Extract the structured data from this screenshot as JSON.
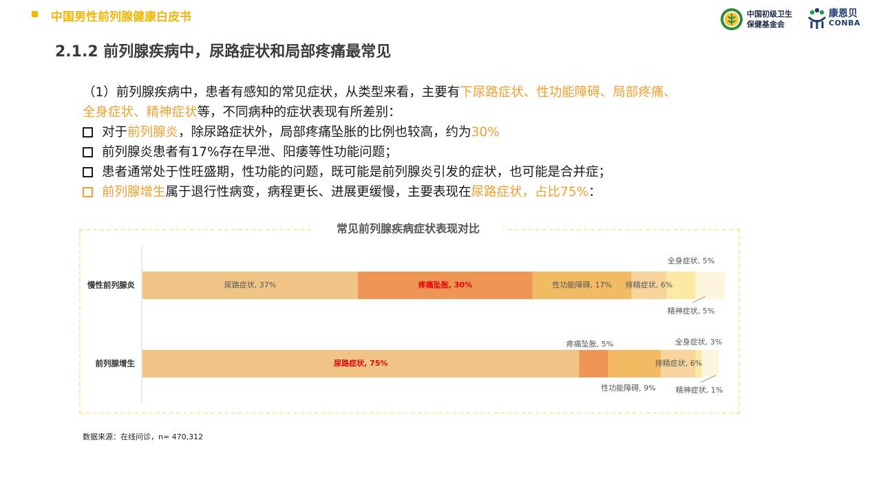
{
  "header": {
    "title": "中国男性前列腺健康白皮书",
    "org_logo_line1": "中国初级卫生",
    "org_logo_line2": "保健基金会",
    "brand_cn": "康恩贝",
    "brand_en": "CONBA"
  },
  "section_title": "2.1.2 前列腺疾病中，尿路症状和局部疼痛最常见",
  "paragraph": {
    "line1_a": "（1）前列腺疾病中，患者有感知的常见症状，从类型来看，主要有",
    "line1_hl": "下尿路症状、性功能障碍、局部疼痛、",
    "line2_hl": "全身症状、精神症状",
    "line2_b": "等，不同病种的症状表现有所差别："
  },
  "bullets": [
    {
      "a": "对于",
      "hl1": "前列腺炎",
      "b": "，除尿路症状外，局部疼痛坠胀的比例也较高，约为",
      "hl2": "30%"
    },
    {
      "text": "前列腺炎患者有17%存在早泄、阳痿等性功能问题；"
    },
    {
      "text": "患者通常处于性旺盛期，性功能的问题，既可能是前列腺炎引发的症状，也可能是合并症；"
    },
    {
      "hl1": "前列腺增生",
      "b": "属于退行性病变，病程更长、进展更缓慢，主要表现在",
      "hl2": "尿路症状，占比75%",
      "c": "："
    }
  ],
  "chart_data": {
    "type": "bar",
    "orientation": "horizontal",
    "stacked": true,
    "title": "常见前列腺疾病症状表现对比",
    "categories": [
      "慢性前列腺炎",
      "前列腺增生"
    ],
    "series": [
      {
        "name": "尿路症状",
        "values": [
          37,
          75
        ],
        "color": "#f0c485",
        "labels": [
          "尿路症状, 37%",
          "尿路症状, 75%"
        ]
      },
      {
        "name": "疼痛坠胀",
        "values": [
          30,
          5
        ],
        "color": "#ed9655",
        "labels": [
          "疼痛坠胀, 30%",
          "疼痛坠胀, 5%"
        ]
      },
      {
        "name": "性功能障碍",
        "values": [
          17,
          9
        ],
        "color": "#f2bb63",
        "labels": [
          "性功能障碍, 17%",
          "性功能障碍, 9%"
        ]
      },
      {
        "name": "排精症状",
        "values": [
          6,
          6
        ],
        "color": "#f8d49d",
        "labels": [
          "排精症状, 6%",
          "排精症状, 6%"
        ]
      },
      {
        "name": "精神症状",
        "values": [
          5,
          1
        ],
        "color": "#fbe9a4",
        "labels": [
          "精神症状, 5%",
          "精神症状, 1%"
        ]
      },
      {
        "name": "全身症状",
        "values": [
          5,
          3
        ],
        "color": "#fdf6dc",
        "labels": [
          "全身症状, 5%",
          "全身症状, 3%"
        ]
      }
    ],
    "xlim": [
      0,
      100
    ],
    "highlight_color": "#e8000a",
    "source": "数据来源：在线问诊，n= 470,312"
  }
}
